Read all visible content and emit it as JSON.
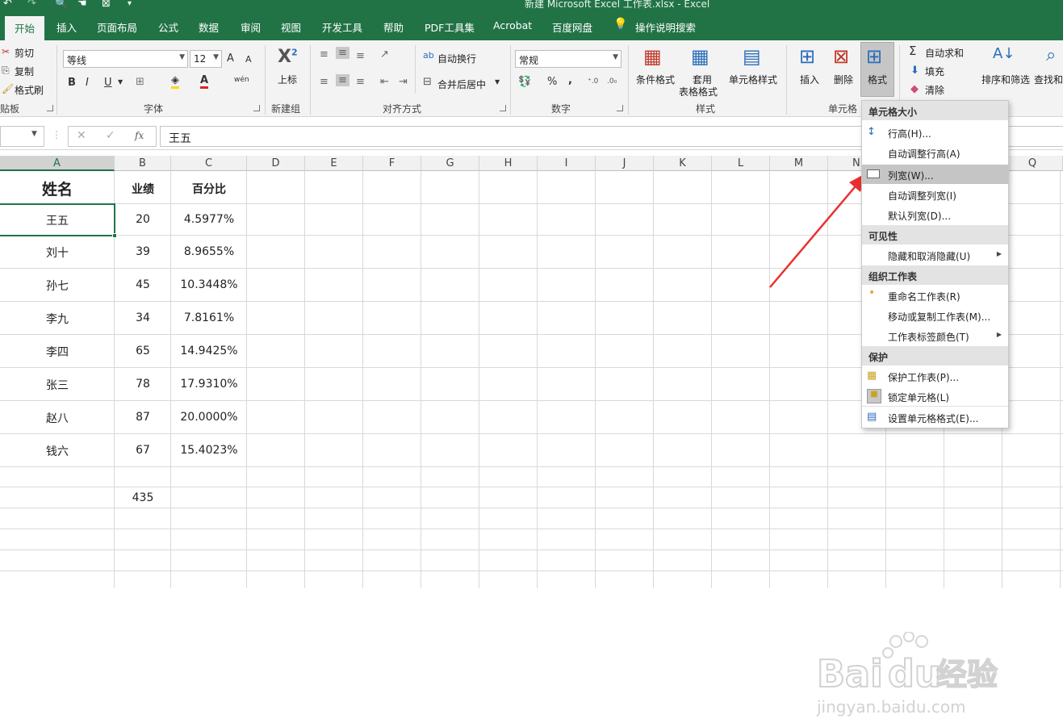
{
  "window": {
    "title": "新建 Microsoft Excel 工作表.xlsx  -  Excel"
  },
  "tabs": [
    "开始",
    "插入",
    "页面布局",
    "公式",
    "数据",
    "审阅",
    "视图",
    "开发工具",
    "帮助",
    "PDF工具集",
    "Acrobat",
    "百度网盘",
    "操作说明搜索"
  ],
  "ribbon": {
    "clipboard": {
      "cut": "剪切",
      "copy": "复制",
      "format_painter": "格式刷",
      "label": "贴板"
    },
    "font": {
      "name": "等线",
      "size": "12",
      "bold": "B",
      "italic": "I",
      "underline": "U",
      "grow": "A",
      "shrink": "A",
      "label": "字体",
      "phonetic": "wén"
    },
    "new_group": {
      "superscript": "上标",
      "label": "新建组"
    },
    "alignment": {
      "wrap": "自动换行",
      "merge": "合并后居中",
      "label": "对齐方式"
    },
    "number": {
      "format": "常规",
      "percent": "%",
      "comma": ",",
      "label": "数字"
    },
    "styles": {
      "conditional": "条件格式",
      "table1": "套用",
      "table2": "表格格式",
      "cell_styles": "单元格样式",
      "label": "样式"
    },
    "cells": {
      "insert": "插入",
      "delete": "删除",
      "format": "格式",
      "label": "单元格"
    },
    "editing": {
      "autosum": "自动求和",
      "fill": "填充",
      "clear": "清除",
      "sort": "排序和筛选",
      "find": "查找和"
    }
  },
  "formula_bar": {
    "value": "王五",
    "fx": "fx"
  },
  "grid": {
    "columns": [
      "A",
      "B",
      "C",
      "D",
      "E",
      "F",
      "G",
      "H",
      "I",
      "J",
      "K",
      "L",
      "M",
      "N",
      "Q"
    ],
    "header": {
      "name": "姓名",
      "performance": "业绩",
      "percent": "百分比"
    },
    "rows": [
      {
        "name": "王五",
        "score": "20",
        "pct": "4.5977%"
      },
      {
        "name": "刘十",
        "score": "39",
        "pct": "8.9655%"
      },
      {
        "name": "孙七",
        "score": "45",
        "pct": "10.3448%"
      },
      {
        "name": "李九",
        "score": "34",
        "pct": "7.8161%"
      },
      {
        "name": "李四",
        "score": "65",
        "pct": "14.9425%"
      },
      {
        "name": "张三",
        "score": "78",
        "pct": "17.9310%"
      },
      {
        "name": "赵八",
        "score": "87",
        "pct": "20.0000%"
      },
      {
        "name": "钱六",
        "score": "67",
        "pct": "15.4023%"
      }
    ],
    "total": "435"
  },
  "format_menu": {
    "sections": {
      "cell_size": "单元格大小",
      "visibility": "可见性",
      "organize": "组织工作表",
      "protection": "保护"
    },
    "items": {
      "row_height": "行高(H)...",
      "autofit_row": "自动调整行高(A)",
      "col_width": "列宽(W)...",
      "autofit_col": "自动调整列宽(I)",
      "default_width": "默认列宽(D)...",
      "hide_unhide": "隐藏和取消隐藏(U)",
      "rename": "重命名工作表(R)",
      "move_copy": "移动或复制工作表(M)...",
      "tab_color": "工作表标签颜色(T)",
      "protect_sheet": "保护工作表(P)...",
      "lock_cell": "锁定单元格(L)",
      "format_cells": "设置单元格格式(E)..."
    }
  },
  "watermark": {
    "brand": "Baidu经验",
    "url": "jingyan.baidu.com"
  },
  "colors": {
    "accent": "#217346",
    "arrow": "#e8312f"
  }
}
